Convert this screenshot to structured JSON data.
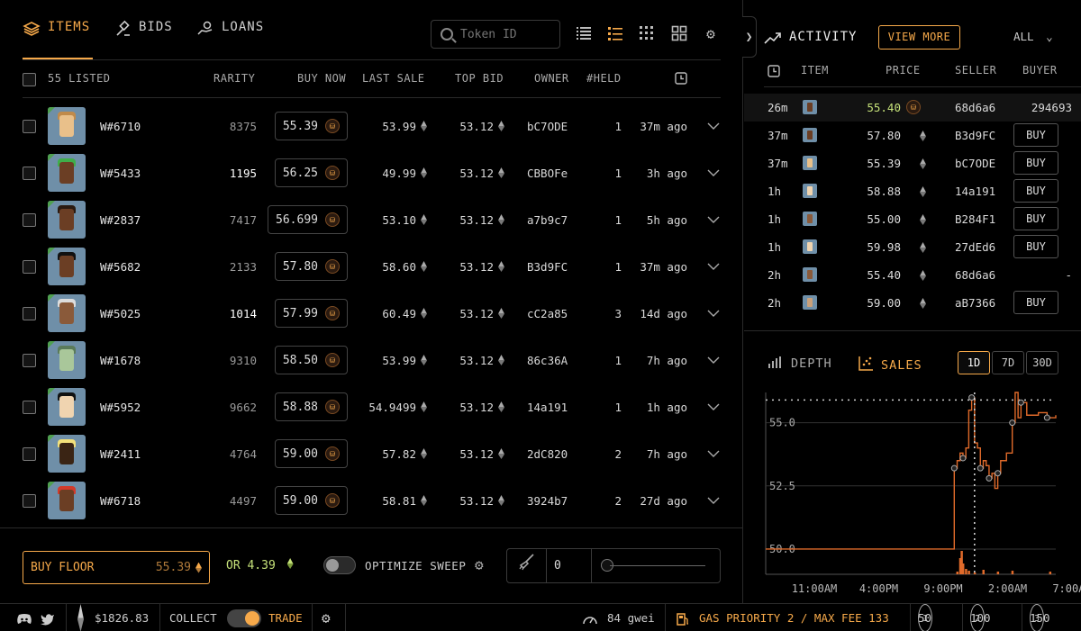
{
  "tabs": [
    {
      "label": "ITEMS",
      "icon": "layers-icon",
      "active": true
    },
    {
      "label": "BIDS",
      "icon": "gavel-icon",
      "active": false
    },
    {
      "label": "LOANS",
      "icon": "hand-coin-icon",
      "active": false
    }
  ],
  "search": {
    "placeholder": "Token ID"
  },
  "toolbar": {
    "icons": [
      "list-compact-icon",
      "list-detail-icon",
      "grid-small-icon",
      "grid-large-icon",
      "gear-icon"
    ]
  },
  "table": {
    "listed_label": "55 LISTED",
    "headers": {
      "rarity": "RARITY",
      "buy_now": "BUY NOW",
      "last_sale": "LAST SALE",
      "top_bid": "TOP BID",
      "owner": "OWNER",
      "held": "#HELD"
    },
    "rows": [
      {
        "id": "W#6710",
        "rarity": "8375",
        "rare_hl": false,
        "buy_now": "55.39",
        "last_sale": "53.99",
        "top_bid": "53.12",
        "owner": "bC7ODE",
        "held": "1",
        "age": "37m ago",
        "skin": "#e9c08a",
        "hair": "#c08a4a"
      },
      {
        "id": "W#5433",
        "rarity": "1195",
        "rare_hl": true,
        "buy_now": "56.25",
        "last_sale": "49.99",
        "top_bid": "53.12",
        "owner": "CBBOFe",
        "held": "1",
        "age": "3h ago",
        "skin": "#6b3e24",
        "hair": "#3fae4a"
      },
      {
        "id": "W#2837",
        "rarity": "7417",
        "rare_hl": false,
        "buy_now": "56.699",
        "last_sale": "53.10",
        "top_bid": "53.12",
        "owner": "a7b9c7",
        "held": "1",
        "age": "5h ago",
        "skin": "#6b3e24",
        "hair": "#2a1a10"
      },
      {
        "id": "W#5682",
        "rarity": "2133",
        "rare_hl": false,
        "buy_now": "57.80",
        "last_sale": "58.60",
        "top_bid": "53.12",
        "owner": "B3d9FC",
        "held": "1",
        "age": "37m ago",
        "skin": "#6b3e24",
        "hair": "#111111"
      },
      {
        "id": "W#5025",
        "rarity": "1014",
        "rare_hl": true,
        "buy_now": "57.99",
        "last_sale": "60.49",
        "top_bid": "53.12",
        "owner": "cC2a85",
        "held": "3",
        "age": "14d ago",
        "skin": "#8a5a3a",
        "hair": "#dddddd"
      },
      {
        "id": "W#1678",
        "rarity": "9310",
        "rare_hl": false,
        "buy_now": "58.50",
        "last_sale": "53.99",
        "top_bid": "53.12",
        "owner": "86c36A",
        "held": "1",
        "age": "7h ago",
        "skin": "#a9c79a",
        "hair": "#5a7a5a"
      },
      {
        "id": "W#5952",
        "rarity": "9662",
        "rare_hl": false,
        "buy_now": "58.88",
        "last_sale": "54.9499",
        "top_bid": "53.12",
        "owner": "14a191",
        "held": "1",
        "age": "1h ago",
        "skin": "#f0d4b0",
        "hair": "#111111"
      },
      {
        "id": "W#2411",
        "rarity": "4764",
        "rare_hl": false,
        "buy_now": "59.00",
        "last_sale": "57.82",
        "top_bid": "53.12",
        "owner": "2dC820",
        "held": "2",
        "age": "7h ago",
        "skin": "#3a2414",
        "hair": "#f3e07a"
      },
      {
        "id": "W#6718",
        "rarity": "4497",
        "rare_hl": false,
        "buy_now": "59.00",
        "last_sale": "58.81",
        "top_bid": "53.12",
        "owner": "3924b7",
        "held": "2",
        "age": "27d ago",
        "skin": "#6b3e24",
        "hair": "#d23a2a"
      }
    ]
  },
  "bottom": {
    "buy_floor_label": "BUY FLOOR",
    "buy_floor_value": "55.39",
    "or_value": "OR 4.39",
    "optimize_label": "OPTIMIZE SWEEP",
    "sweep_qty": "0"
  },
  "activity": {
    "title": "ACTIVITY",
    "view_more": "VIEW MORE",
    "filter": "ALL",
    "headers": {
      "item": "ITEM",
      "price": "PRICE",
      "seller": "SELLER",
      "buyer": "BUYER"
    },
    "rows": [
      {
        "time": "26m",
        "price": "55.40",
        "currency": "coin",
        "seller": "68d6a6",
        "buyer": "294693",
        "action": "",
        "skin": "#6b3e24"
      },
      {
        "time": "37m",
        "price": "57.80",
        "currency": "eth",
        "seller": "B3d9FC",
        "buyer": "",
        "action": "BUY",
        "skin": "#6b3e24"
      },
      {
        "time": "37m",
        "price": "55.39",
        "currency": "eth",
        "seller": "bC7ODE",
        "buyer": "",
        "action": "BUY",
        "skin": "#e9c08a"
      },
      {
        "time": "1h",
        "price": "58.88",
        "currency": "eth",
        "seller": "14a191",
        "buyer": "",
        "action": "BUY",
        "skin": "#f0d4b0"
      },
      {
        "time": "1h",
        "price": "55.00",
        "currency": "eth",
        "seller": "B284F1",
        "buyer": "",
        "action": "BUY",
        "skin": "#8a5a3a"
      },
      {
        "time": "1h",
        "price": "59.98",
        "currency": "eth",
        "seller": "27dEd6",
        "buyer": "",
        "action": "BUY",
        "skin": "#f0d4b0"
      },
      {
        "time": "2h",
        "price": "55.40",
        "currency": "eth",
        "seller": "68d6a6",
        "buyer": "-",
        "action": "",
        "skin": "#8a5a3a"
      },
      {
        "time": "2h",
        "price": "59.00",
        "currency": "eth",
        "seller": "aB7366",
        "buyer": "",
        "action": "BUY",
        "skin": "#c9a07a"
      }
    ]
  },
  "chart_tabs": {
    "depth": "DEPTH",
    "sales": "SALES"
  },
  "ranges": [
    {
      "label": "1D",
      "active": true
    },
    {
      "label": "7D",
      "active": false
    },
    {
      "label": "30D",
      "active": false
    }
  ],
  "chart_data": {
    "type": "line",
    "xlabel": "",
    "ylabel": "",
    "y_ticks": [
      "55.0",
      "52.5",
      "50.0"
    ],
    "x_ticks": [
      "11:00AM",
      "4:00PM",
      "9:00PM",
      "2:00AM",
      "7:00AM"
    ],
    "ylim": [
      49.0,
      56.2
    ],
    "floor_reference": 55.9,
    "grid": true,
    "series": [
      {
        "points": [
          [
            0,
            50.0
          ],
          [
            0.2,
            50.0
          ],
          [
            0.4,
            50.0
          ],
          [
            0.55,
            50.0
          ],
          [
            0.6,
            50.0
          ],
          [
            0.64,
            50.0
          ],
          [
            0.65,
            53.2
          ],
          [
            0.66,
            53.5
          ],
          [
            0.67,
            53.8
          ],
          [
            0.68,
            53.6
          ],
          [
            0.69,
            54.0
          ],
          [
            0.7,
            55.5
          ],
          [
            0.71,
            56.0
          ],
          [
            0.72,
            54.2
          ],
          [
            0.73,
            54.0
          ],
          [
            0.74,
            53.2
          ],
          [
            0.75,
            53.5
          ],
          [
            0.76,
            53.3
          ],
          [
            0.77,
            52.8
          ],
          [
            0.78,
            53.0
          ],
          [
            0.79,
            52.4
          ],
          [
            0.8,
            53.0
          ],
          [
            0.81,
            53.5
          ],
          [
            0.83,
            53.8
          ],
          [
            0.85,
            55.0
          ],
          [
            0.86,
            56.2
          ],
          [
            0.87,
            55.2
          ],
          [
            0.88,
            55.8
          ],
          [
            0.9,
            55.3
          ],
          [
            0.94,
            55.4
          ],
          [
            0.97,
            55.2
          ],
          [
            1.0,
            55.3
          ]
        ]
      }
    ],
    "volume": [
      [
        0.66,
        3
      ],
      [
        0.67,
        18
      ],
      [
        0.675,
        26
      ],
      [
        0.68,
        12
      ],
      [
        0.69,
        6
      ],
      [
        0.7,
        4
      ],
      [
        0.72,
        2
      ],
      [
        0.75,
        5
      ],
      [
        0.8,
        3
      ],
      [
        0.85,
        4
      ],
      [
        0.98,
        3
      ]
    ]
  },
  "footer": {
    "eth_price": "$1826.83",
    "collect": "COLLECT",
    "trade": "TRADE",
    "gwei": "84 gwei",
    "gas_label": "GAS PRIORITY 2 / MAX FEE 133",
    "opt1": "50",
    "opt2": "100",
    "opt3": "150",
    "opt1_num": "1",
    "opt2_num": "2",
    "opt3_num": "3"
  }
}
